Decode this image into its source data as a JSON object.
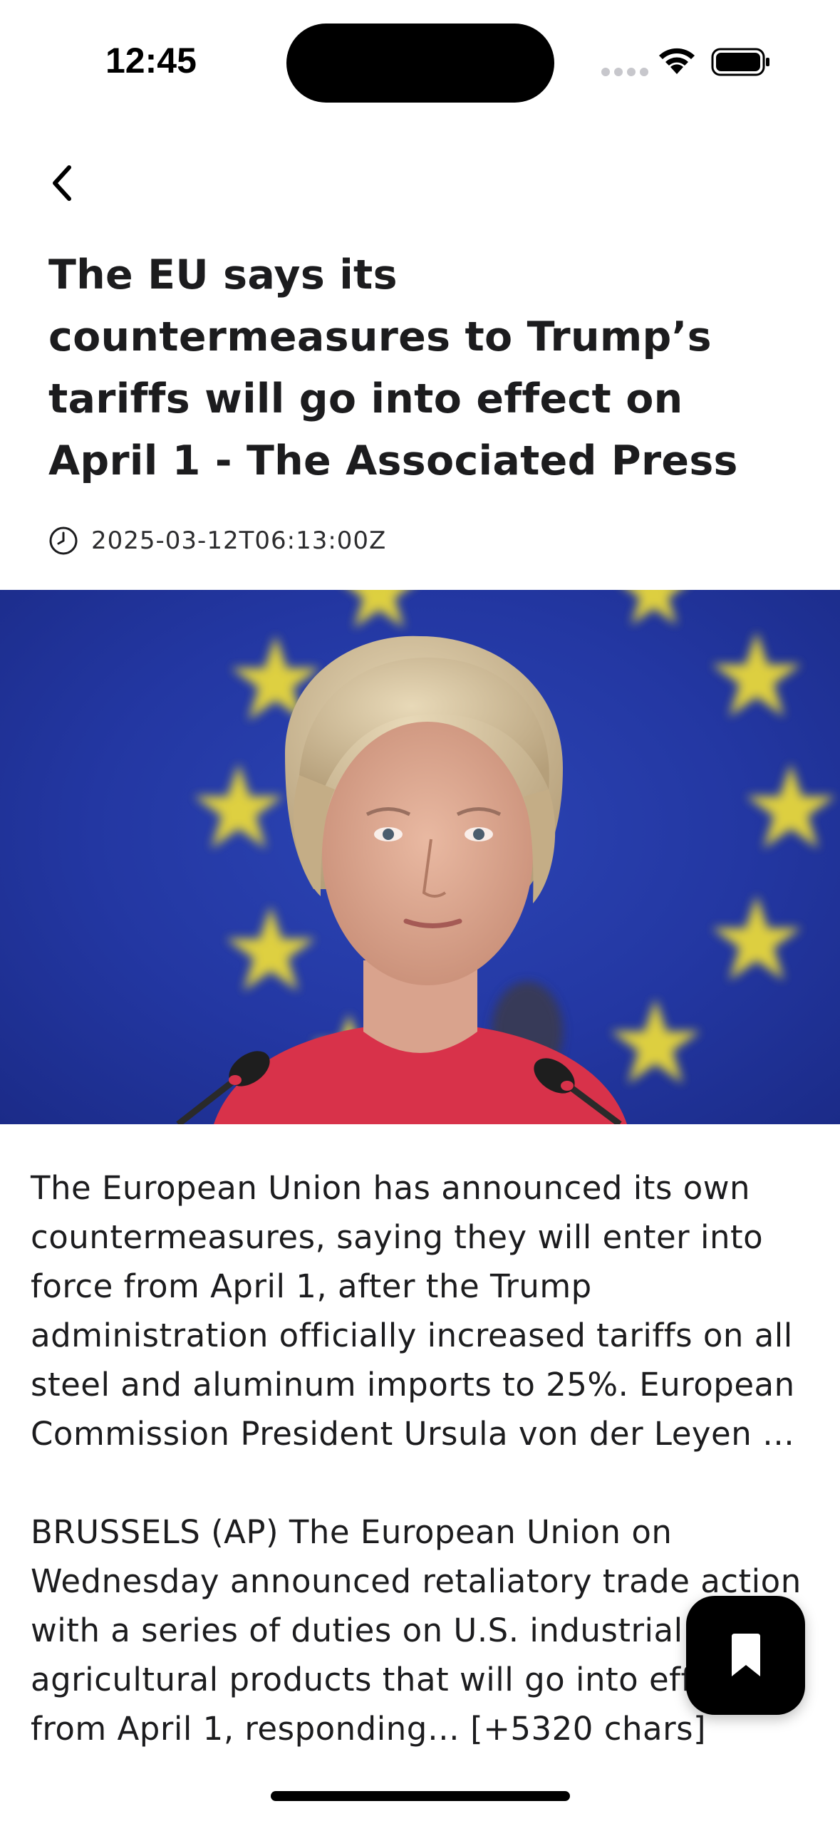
{
  "status_bar": {
    "time": "12:45"
  },
  "nav": {
    "back_icon": "chevron-left-icon"
  },
  "article": {
    "title": "The EU says its countermeasures to Trump’s tariffs will go into effect on April 1 - The Associated Press",
    "published_at": "2025-03-12T06:13:00Z",
    "clock_icon": "clock-icon",
    "summary": "The European Union has announced its own countermeasures, saying they will enter into force from April 1, after the Trump administration officially increased tariffs on all steel and aluminum imports to 25%. European Commission President Ursula von der Leyen …",
    "body_excerpt": "BRUSSELS (AP) The European Union on Wednesday announced retaliatory trade action with a series of duties on U.S. industrial and agricultural products that will go into effect from April 1, responding… [+5320 chars]"
  },
  "actions": {
    "bookmark_icon": "bookmark-icon"
  },
  "colors": {
    "accent": "#000000",
    "hero_blue": "#2337a2",
    "star_yellow": "#e8d83a",
    "jacket_red": "#d8324a"
  }
}
